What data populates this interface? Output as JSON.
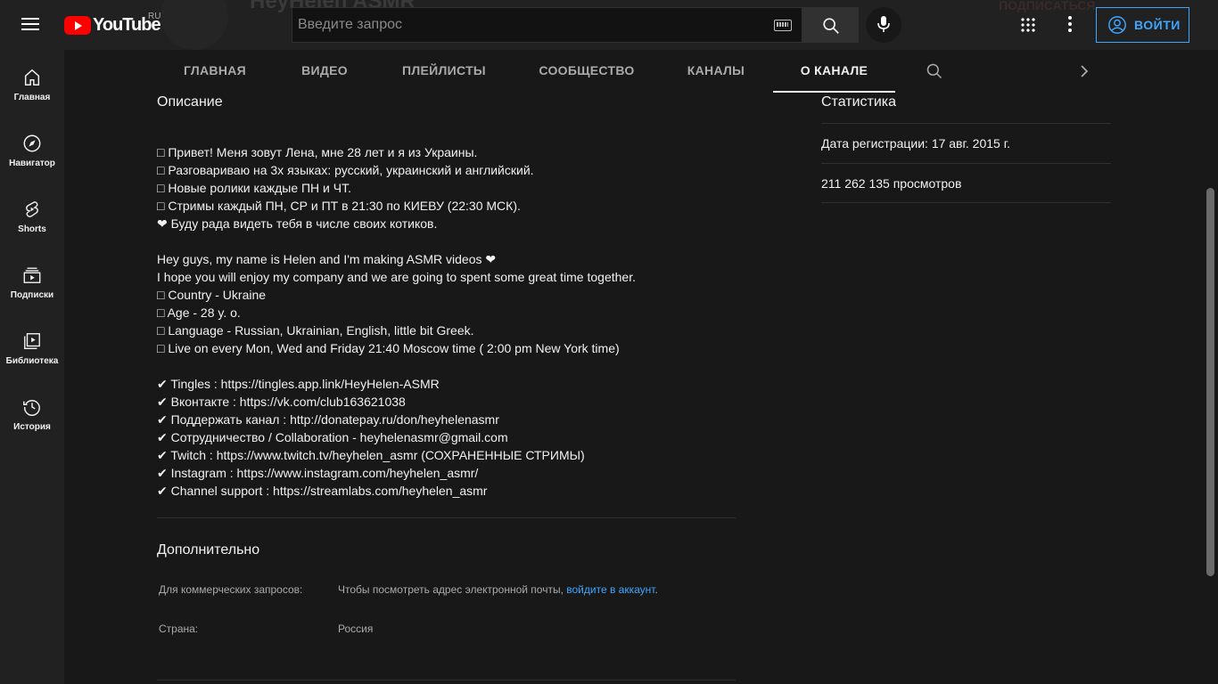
{
  "header": {
    "logo_text": "YouTube",
    "region": "RU",
    "channel_name_ghost": "HeyHelen ASMR",
    "subscriptions_ghost": "ПОДПИСАТЬСЯ",
    "search_placeholder": "Введите запрос",
    "signin_label": "ВОЙТИ"
  },
  "sidebar": {
    "items": [
      {
        "label": "Главная",
        "icon": "home-icon"
      },
      {
        "label": "Навигатор",
        "icon": "compass-icon"
      },
      {
        "label": "Shorts",
        "icon": "shorts-icon"
      },
      {
        "label": "Подписки",
        "icon": "subscriptions-icon"
      },
      {
        "label": "Библиотека",
        "icon": "library-icon"
      },
      {
        "label": "История",
        "icon": "history-icon"
      }
    ]
  },
  "tabs": [
    {
      "label": "ГЛАВНАЯ",
      "active": false
    },
    {
      "label": "ВИДЕО",
      "active": false
    },
    {
      "label": "ПЛЕЙЛИСТЫ",
      "active": false
    },
    {
      "label": "СООБЩЕСТВО",
      "active": false
    },
    {
      "label": "КАНАЛЫ",
      "active": false
    },
    {
      "label": "О КАНАЛЕ",
      "active": true
    }
  ],
  "description": {
    "title": "Описание",
    "lines": [
      "□ Привет! Меня зовут Лена, мне 28 лет и я из Украины.",
      "□ Разговариваю на 3х языках: русский, украинский и английский.",
      "□ Новые ролики каждые ПН и ЧТ.",
      "□ Стримы каждый ПН, СР и ПТ в 21:30 по КИЕВУ (22:30 МСК).",
      "❤ Буду рада видеть тебя в числе своих котиков.",
      "",
      "Hey guys, my name is Helen and I'm making ASMR videos ❤",
      "I hope you will enjoy my company and we are going to spent some great time together.",
      "□ Country - Ukraine",
      "□ Age - 28 y. o.",
      "□ Language - Russian, Ukrainian, English, little bit Greek.",
      "□ Live on every Mon, Wed and Friday 21:40 Moscow time ( 2:00 pm New York time)",
      "",
      "✔ Tingles : https://tingles.app.link/HeyHelen-ASMR",
      "✔ Вконтакте : https://vk.com/club163621038",
      "✔ Поддержать канал : http://donatepay.ru/don/heyhelenasmr",
      "✔ Сотрудничество / Collaboration - heyhelenasmr@gmail.com",
      "✔ Twitch : https://www.twitch.tv/heyhelen_asmr (СОХРАНЕННЫЕ СТРИМЫ)",
      "✔ Instagram : https://www.instagram.com/heyhelen_asmr/",
      "✔ Channel support : https://streamlabs.com/heyhelen_asmr"
    ]
  },
  "details": {
    "title": "Дополнительно",
    "business_label": "Для коммерческих запросов:",
    "business_text": "Чтобы посмотреть адрес электронной почты, ",
    "business_link": "войдите в аккаунт",
    "business_suffix": ".",
    "country_label": "Страна:",
    "country_value": "Россия"
  },
  "stats": {
    "title": "Статистика",
    "joined": "Дата регистрации: 17 авг. 2015 г.",
    "views": "211 262 135 просмотров"
  },
  "colors": {
    "background": "#181818",
    "bar": "#212121",
    "accent": "#3ea6ff",
    "logo_red": "#ff0000"
  }
}
